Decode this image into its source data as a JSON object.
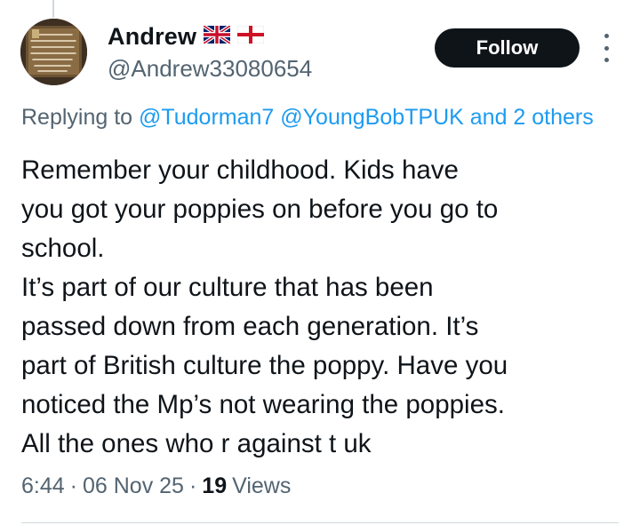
{
  "author": {
    "display_name": "Andrew",
    "handle": "@Andrew33080654",
    "flags": [
      "uk-flag-icon",
      "england-flag-icon"
    ]
  },
  "actions": {
    "follow_label": "Follow",
    "more_icon": "more-vertical-icon"
  },
  "reply_context": {
    "prefix": "Replying to",
    "mention_1": "@Tudorman7",
    "mention_2": "@YoungBobTPUK",
    "suffix": "and 2 others"
  },
  "tweet": {
    "text": "Remember your childhood. Kids have\nyou got your poppies on before you go to\nschool.\nIt’s part of our culture that has been\npassed down from each generation. It’s\npart of British culture the poppy. Have you\nnoticed the Mp’s not wearing the poppies.\nAll the ones who r against t uk"
  },
  "meta": {
    "time": "6:44",
    "separator": "·",
    "date": "06 Nov 25",
    "views_count": "19",
    "views_label": "Views"
  },
  "colors": {
    "text": "#0f1419",
    "secondary": "#536471",
    "link": "#1d9bf0",
    "button_bg": "#0f1419"
  }
}
